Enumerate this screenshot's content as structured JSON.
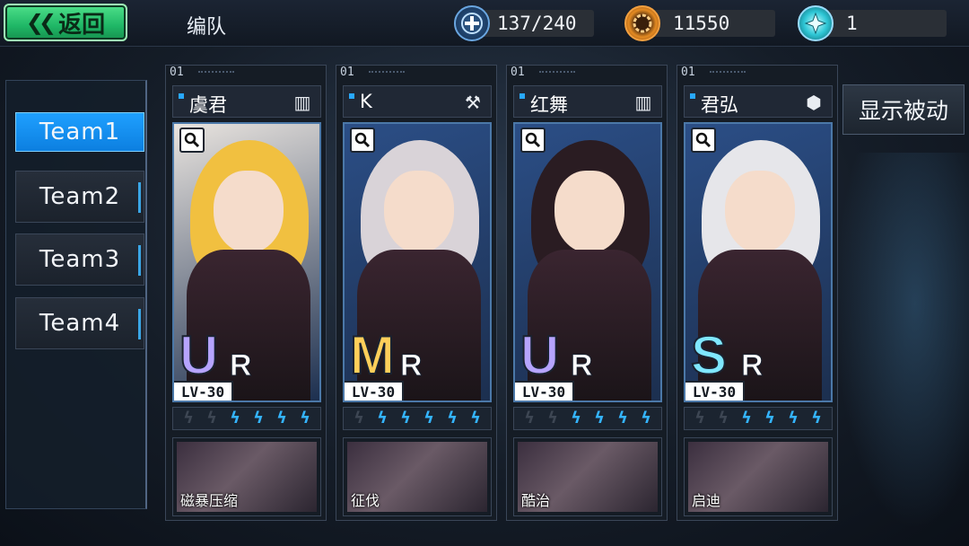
{
  "header": {
    "back_label": "返回",
    "title": "编队"
  },
  "resources": [
    {
      "icon": "plus-coin-icon",
      "value": "137/240"
    },
    {
      "icon": "gear-coin-icon",
      "value": "11550"
    },
    {
      "icon": "crystal-icon",
      "value": "1"
    }
  ],
  "teams": [
    {
      "label": "Team1",
      "active": true
    },
    {
      "label": "Team2",
      "active": false
    },
    {
      "label": "Team3",
      "active": false
    },
    {
      "label": "Team4",
      "active": false
    }
  ],
  "passive_button": "显示被动",
  "cards": [
    {
      "slot": "01",
      "name": "虞君",
      "class_icon": "armor-icon",
      "rarity_main": "U",
      "rarity_sub": "R",
      "rarity_color": "#b6a4ff",
      "level": "LV-30",
      "stars_on": 4,
      "stars_total": 6,
      "skill": "磁暴压缩",
      "portrait_bg": "#e9e4df",
      "hair": "#f1c040"
    },
    {
      "slot": "01",
      "name": "K",
      "class_icon": "scythe-icon",
      "rarity_main": "M",
      "rarity_sub": "R",
      "rarity_color": "#ffcf5a",
      "level": "LV-30",
      "stars_on": 5,
      "stars_total": 6,
      "skill": "征伐",
      "portrait_bg": "#2b4e86",
      "hair": "#d9d3d8"
    },
    {
      "slot": "01",
      "name": "红舞",
      "class_icon": "armor-icon",
      "rarity_main": "U",
      "rarity_sub": "R",
      "rarity_color": "#b6a4ff",
      "level": "LV-30",
      "stars_on": 4,
      "stars_total": 6,
      "skill": "酷治",
      "portrait_bg": "#2b4e86",
      "hair": "#2a1c22"
    },
    {
      "slot": "01",
      "name": "君弘",
      "class_icon": "molecule-icon",
      "rarity_main": "S",
      "rarity_sub": "R",
      "rarity_color": "#7fe7ff",
      "level": "LV-30",
      "stars_on": 4,
      "stars_total": 6,
      "skill": "启迪",
      "portrait_bg": "#2b4e86",
      "hair": "#e6e6ea"
    }
  ]
}
